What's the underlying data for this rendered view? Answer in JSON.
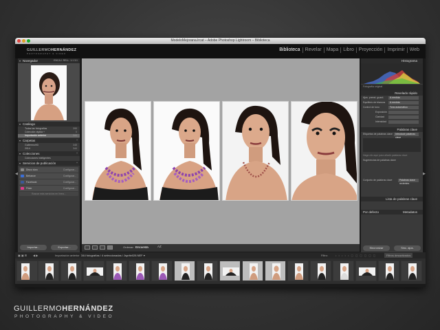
{
  "window": {
    "title": "ModeloMejorana.lrcat – Adobe Photoshop Lightroom – Biblioteca",
    "brand_line1_a": "GUILLERMO",
    "brand_line1_b": "HERNÁNDEZ",
    "brand_line2": "PHOTOGRAPHY & VIDEO"
  },
  "modules": [
    "Biblioteca",
    "Revelar",
    "Mapa",
    "Libro",
    "Proyección",
    "Imprimir",
    "Web"
  ],
  "active_module": "Biblioteca",
  "left_panel": {
    "navigator": {
      "title": "Navegador",
      "zoom_options": "ENCAJ. RELL. 1:1 3:1"
    },
    "catalog": {
      "title": "Catálogo",
      "items": [
        {
          "label": "Todas las fotografías",
          "count": "395"
        },
        {
          "label": "Colección rápida +",
          "count": "0"
        },
        {
          "label": "Importación anterior",
          "count": "344"
        }
      ]
    },
    "folders": {
      "title": "Carpetas",
      "items": [
        {
          "label": "GuillermoHD",
          "count": "348"
        },
        {
          "label": "2014",
          "count": "344"
        }
      ]
    },
    "collections": {
      "title": "Colecciones",
      "items": [
        {
          "label": "Colecciones inteligentes",
          "count": ""
        }
      ]
    },
    "publish": {
      "title": "Servicios de publicación",
      "items": [
        {
          "label": "Disco duro",
          "action": "Configurar...",
          "color": "#8a8a8a"
        },
        {
          "label": "Behance",
          "action": "Configurar...",
          "color": "#3b6fd9"
        },
        {
          "label": "Facebook",
          "action": "Configurar...",
          "color": "#3b5998"
        },
        {
          "label": "Flickr",
          "action": "Configurar...",
          "color": "#e03a8c"
        }
      ],
      "find_more": "Buscar más servicios en línea..."
    },
    "import_button": "Importar...",
    "export_button": "Exportar..."
  },
  "toolbar": {
    "sort_label": "Ordenar:",
    "sort_value": "Encuesta",
    "sort_icon": "AZ"
  },
  "right_panel": {
    "histogram_title": "Histograma",
    "original_photo_label": "Fotografía original",
    "quick_develop": {
      "title": "Revelado rápido",
      "rows": [
        {
          "label": "Ajus. preest. guard.",
          "value": "A medida"
        },
        {
          "label": "Equilibrio de blancos",
          "value": "A medida"
        },
        {
          "label": "Control de tono",
          "value": "Tono automático"
        },
        {
          "label": "Exposición",
          "value": ""
        },
        {
          "label": "Claridad",
          "value": ""
        },
        {
          "label": "Intensidad",
          "value": ""
        }
      ]
    },
    "keywords": {
      "title": "Palabras clave",
      "rows": [
        {
          "label": "Etiquetas de palabras clave",
          "value": "Introducir palabras clave"
        },
        {
          "label": "Sugerencias de palabras clave",
          "value": ""
        },
        {
          "label": "Conjunto de palabras clave",
          "value": "Palabras clave recientes"
        }
      ],
      "hint": "Haga clic aquí para añadir palabras clave"
    },
    "keyword_list_title": "Lista de palabras clave",
    "metadata_title": "Metadatos",
    "metadata_preset": "Por defecto",
    "sync_button": "Sincronizar",
    "sync_settings_button": "Sinc. ajus."
  },
  "filter_bar": {
    "source": "Importación anterior",
    "count_text": "344 fotografías / 4 seleccionadas / Jsprite028.NEF ▾",
    "filter_label": "Filtro:",
    "filter_value": "Filtros desactivados"
  },
  "colors": {
    "accent_active": "#ffffff",
    "panel_bg": "#3a3a3a",
    "grid_bg": "#a3a3a3",
    "lips_purple": "#9b59b6"
  },
  "watermark": {
    "line1_a": "GUILLERMO",
    "line1_b": "HERNÁNDEZ",
    "line2": "PHOTOGRAPHY & VIDEO"
  }
}
